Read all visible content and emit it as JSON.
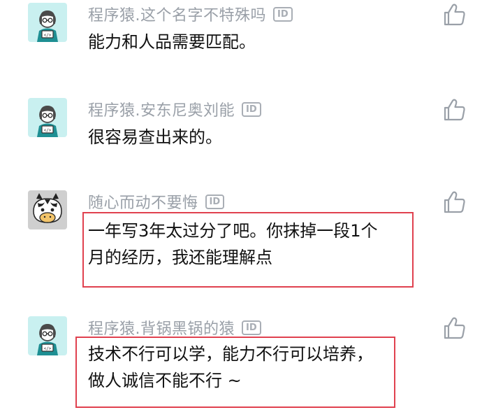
{
  "comments": [
    {
      "username": "程序猿.这个名字不特殊吗",
      "id_badge": "ID",
      "lines": [
        "能力和人品需要匹配。"
      ],
      "avatar_icon": "programmer-avatar-icon"
    },
    {
      "username": "程序猿.安东尼奥刘能",
      "id_badge": "ID",
      "lines": [
        "很容易查出来的。"
      ],
      "avatar_icon": "programmer-avatar-icon"
    },
    {
      "username": "随心而动不要悔",
      "id_badge": "ID",
      "lines": [
        "一年写3年太过分了吧。你抹掉一段1个",
        "月的经历，我还能理解点"
      ],
      "avatar_icon": "zebra-avatar-icon",
      "highlighted": true
    },
    {
      "username": "程序猿.背锅黑锅的猿",
      "id_badge": "ID",
      "lines": [
        "技术不行可以学，能力不行可以培养，",
        "做人诚信不能不行 ~"
      ],
      "avatar_icon": "programmer-avatar-icon",
      "highlighted": true
    }
  ],
  "icons": {
    "like": "thumbs-up-icon"
  },
  "colors": {
    "username": "#9aa0a8",
    "text": "#111111",
    "highlight_border": "#e0414f",
    "avatar_bg": "#c9f0f0"
  }
}
